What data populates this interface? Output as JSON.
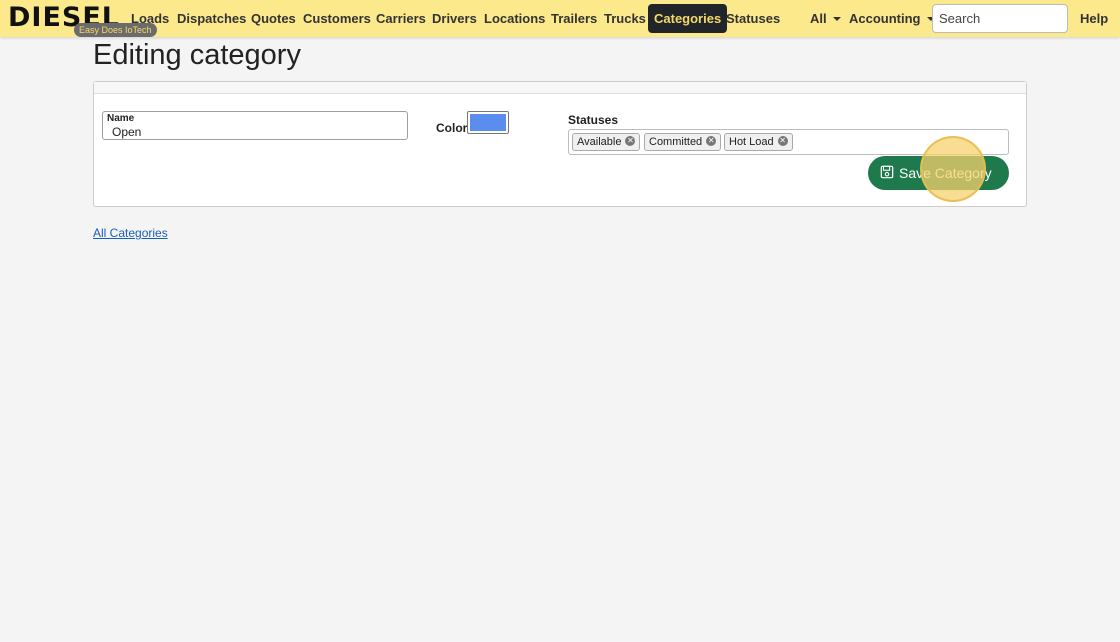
{
  "brand": {
    "name": "DIESEL",
    "tagline": "Easy Does IoTech"
  },
  "nav": {
    "items": [
      {
        "label": "Loads"
      },
      {
        "label": "Dispatches"
      },
      {
        "label": "Quotes"
      },
      {
        "label": "Customers"
      },
      {
        "label": "Carriers"
      },
      {
        "label": "Drivers"
      },
      {
        "label": "Locations"
      },
      {
        "label": "Trailers"
      },
      {
        "label": "Trucks"
      },
      {
        "label": "Categories",
        "active": true
      },
      {
        "label": "Statuses"
      }
    ],
    "dropdowns": [
      {
        "label": "All"
      },
      {
        "label": "Accounting"
      }
    ],
    "search_placeholder": "Search",
    "help_label": "Help"
  },
  "page": {
    "title": "Editing category",
    "form": {
      "name_label": "Name",
      "name_value": "Open",
      "color_label": "Color",
      "color_value": "#5b8def",
      "statuses_label": "Statuses",
      "statuses": [
        {
          "label": "Available"
        },
        {
          "label": "Committed"
        },
        {
          "label": "Hot Load"
        }
      ],
      "save_label": "Save Category"
    },
    "back_link": "All Categories"
  }
}
